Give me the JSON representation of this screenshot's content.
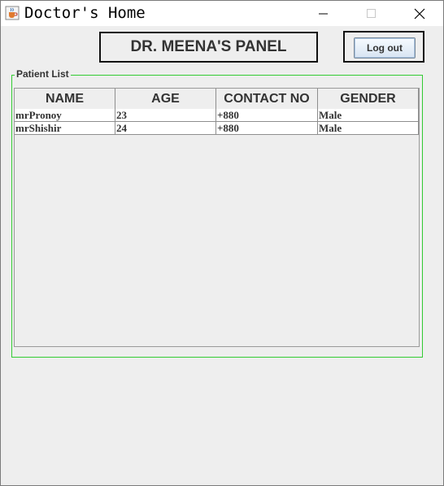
{
  "window": {
    "title": "Doctor's Home",
    "icons": {
      "app": "java-coffee-cup-icon",
      "minimize": "minimize-icon",
      "maximize": "maximize-icon",
      "close": "close-icon"
    }
  },
  "panel": {
    "title": "DR. MEENA'S PANEL",
    "logout_label": "Log out"
  },
  "patient_list": {
    "legend": "Patient List",
    "columns": [
      "NAME",
      "AGE",
      "CONTACT NO",
      "GENDER"
    ],
    "rows": [
      [
        "mrPronoy",
        "23",
        "+880",
        "Male"
      ],
      [
        "mrShishir",
        "24",
        "+880",
        "Male"
      ]
    ]
  },
  "colors": {
    "fieldset_border": "#33cc33",
    "background": "#eeeeee"
  }
}
